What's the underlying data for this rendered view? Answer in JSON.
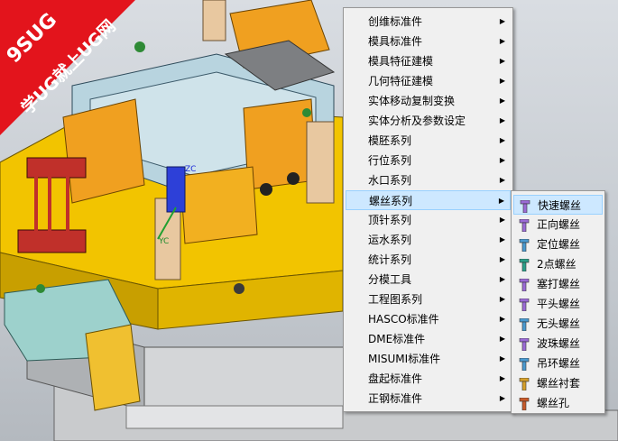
{
  "watermark": {
    "brand": "9SUG",
    "slogan": "学UG就上UG网"
  },
  "menu": {
    "items": [
      {
        "label": "创维标准件"
      },
      {
        "label": "模具标准件"
      },
      {
        "label": "模具特征建模"
      },
      {
        "label": "几何特征建模"
      },
      {
        "label": "实体移动复制变换"
      },
      {
        "label": "实体分析及参数设定"
      },
      {
        "label": "模胚系列"
      },
      {
        "label": "行位系列"
      },
      {
        "label": "水口系列"
      },
      {
        "label": "螺丝系列"
      },
      {
        "label": "顶针系列"
      },
      {
        "label": "运水系列"
      },
      {
        "label": "统计系列"
      },
      {
        "label": "分模工具"
      },
      {
        "label": "工程图系列"
      },
      {
        "label": "HASCO标准件"
      },
      {
        "label": "DME标准件"
      },
      {
        "label": "MISUMI标准件"
      },
      {
        "label": "盘起标准件"
      },
      {
        "label": "正钢标准件"
      }
    ],
    "active_index": 9
  },
  "submenu": {
    "items": [
      {
        "label": "快速螺丝",
        "icon": "screw-quick-icon"
      },
      {
        "label": "正向螺丝",
        "icon": "screw-forward-icon"
      },
      {
        "label": "定位螺丝",
        "icon": "screw-locating-icon"
      },
      {
        "label": "2点螺丝",
        "icon": "screw-two-point-icon"
      },
      {
        "label": "塞打螺丝",
        "icon": "shoulder-screw-icon"
      },
      {
        "label": "平头螺丝",
        "icon": "flat-head-screw-icon"
      },
      {
        "label": "无头螺丝",
        "icon": "headless-screw-icon"
      },
      {
        "label": "波珠螺丝",
        "icon": "ball-plunger-icon"
      },
      {
        "label": "吊环螺丝",
        "icon": "eye-bolt-icon"
      },
      {
        "label": "螺丝衬套",
        "icon": "screw-bushing-icon"
      },
      {
        "label": "螺丝孔",
        "icon": "screw-hole-icon"
      }
    ],
    "active_index": 0
  },
  "viewport": {
    "axis_labels": {
      "zc": "ZC",
      "yc": "YC"
    },
    "colors": {
      "plate_yellow": "#f2c400",
      "plate_gray": "#b9bcc0",
      "cylinder_red": "#c0302a",
      "cavity_blue": "#b8d4df",
      "insert_teal": "#9dd1cc"
    }
  }
}
